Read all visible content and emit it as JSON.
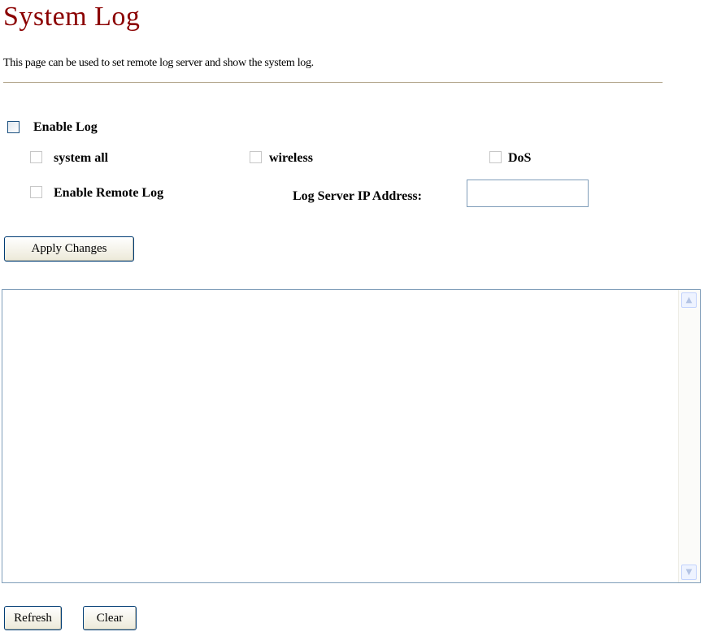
{
  "page": {
    "title": "System Log",
    "description": "This page can be used to set remote log server and show the system log."
  },
  "form": {
    "enable_log": {
      "label": "Enable Log",
      "checked": false
    },
    "system_all": {
      "label": "system all",
      "checked": false
    },
    "wireless": {
      "label": "wireless",
      "checked": false
    },
    "dos": {
      "label": "DoS",
      "checked": false
    },
    "enable_remote_log": {
      "label": "Enable Remote Log",
      "checked": false
    },
    "log_server_ip": {
      "label": "Log Server IP Address:",
      "value": ""
    },
    "apply_label": "Apply Changes"
  },
  "log": {
    "content": "",
    "scroll_up_icon": "chevron-up-icon",
    "scroll_down_icon": "chevron-down-icon"
  },
  "actions": {
    "refresh_label": "Refresh",
    "clear_label": "Clear"
  },
  "colors": {
    "title": "#8b0000",
    "divider": "#b5a990",
    "input_border": "#7f9db9",
    "button_border": "#003c74"
  }
}
